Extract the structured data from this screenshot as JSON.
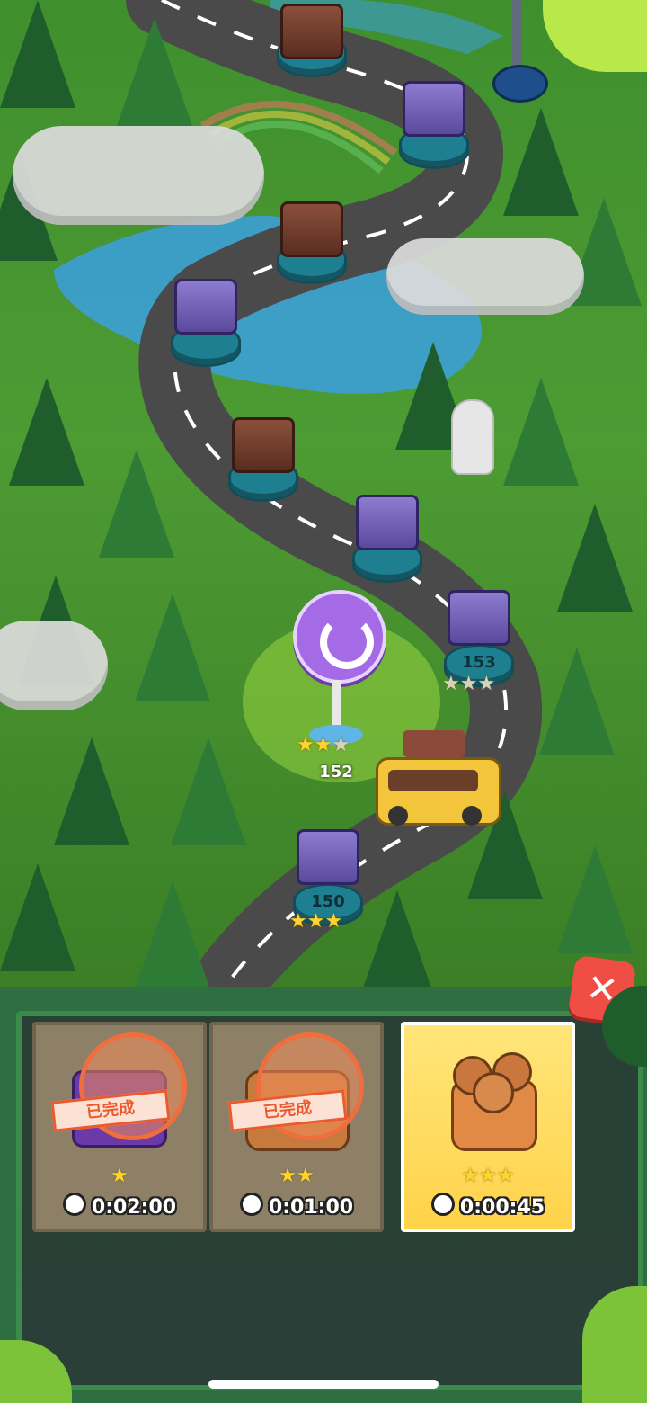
{
  "map": {
    "current_level": {
      "label": "152",
      "stars": [
        true,
        true,
        false
      ]
    },
    "levels": [
      {
        "id": "153",
        "label": "153",
        "stars": [
          false,
          false,
          false
        ]
      },
      {
        "id": "150",
        "label": "150",
        "stars": [
          true,
          true,
          true
        ]
      }
    ]
  },
  "rewards_panel": {
    "cards": [
      {
        "state": "completed",
        "stamp_text": "已完成",
        "stars": "★",
        "time": "0:02:00"
      },
      {
        "state": "completed",
        "stamp_text": "已完成",
        "stars": "★★",
        "time": "0:01:00"
      },
      {
        "state": "active",
        "stamp_text": "",
        "stars": "★★★",
        "time": "0:00:45"
      }
    ],
    "close_icon": "close-icon"
  },
  "colors": {
    "board": "#2a3f37",
    "frame": "#3b8a4c",
    "active_card": "#ffd34a",
    "close": "#f04d45"
  }
}
